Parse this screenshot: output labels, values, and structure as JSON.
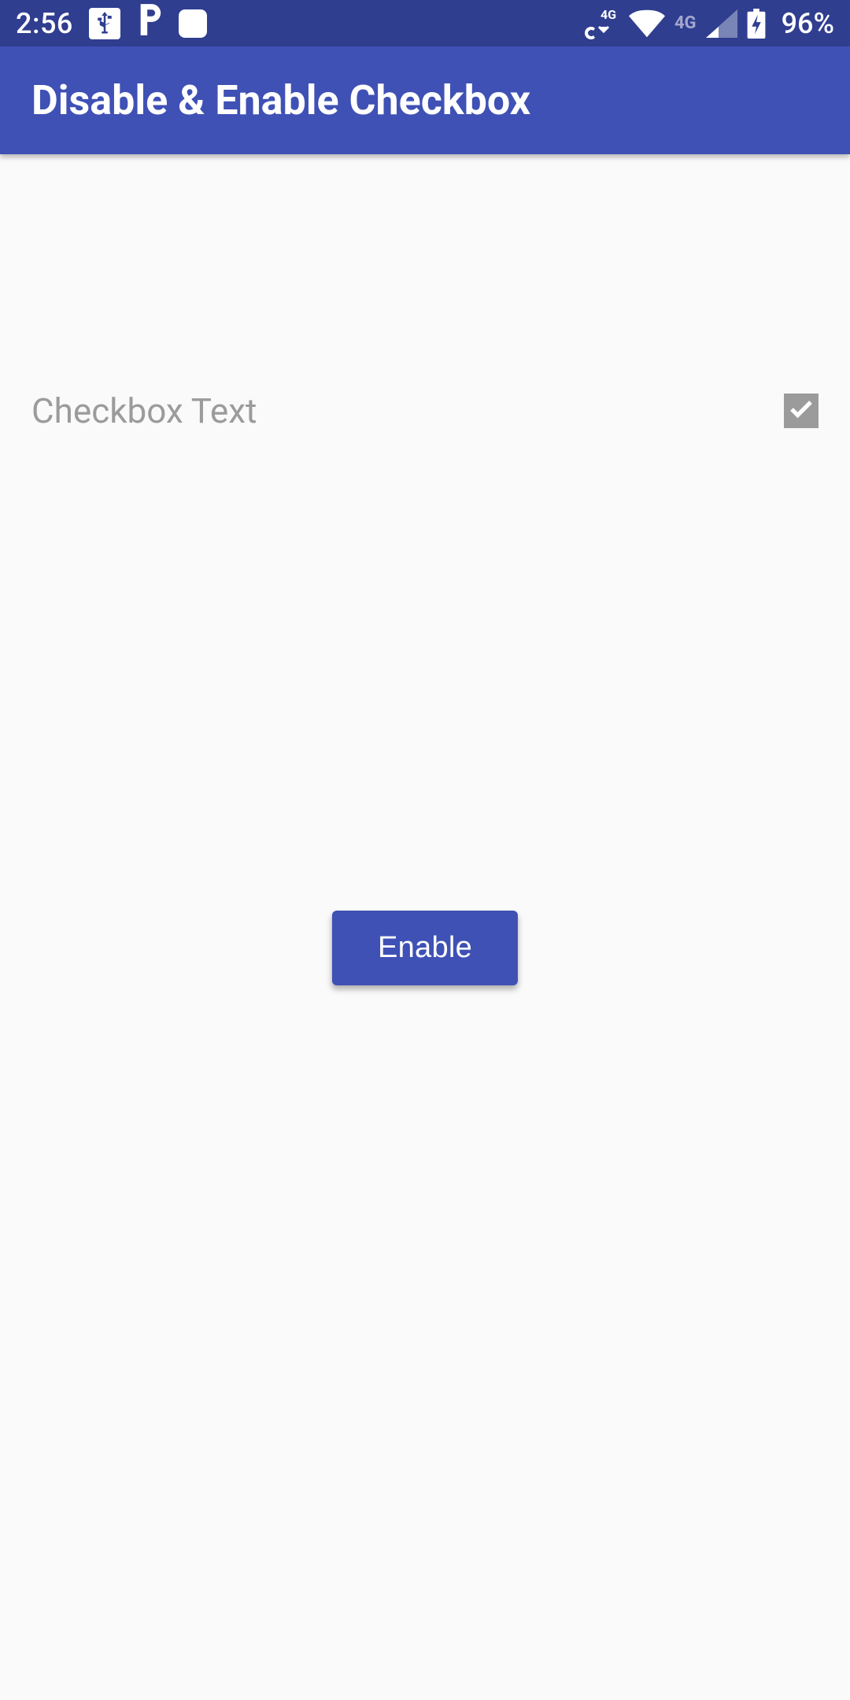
{
  "status_bar": {
    "time": "2:56",
    "battery": "96%",
    "network_label_a": "4G",
    "network_label_b": "4G"
  },
  "app_bar": {
    "title": "Disable & Enable Checkbox"
  },
  "main": {
    "checkbox_label": "Checkbox Text",
    "button_label": "Enable"
  },
  "colors": {
    "primary": "#3f51b5",
    "primary_dark": "#303e90",
    "disabled": "#9b9b9b",
    "bg": "#fafafa"
  }
}
